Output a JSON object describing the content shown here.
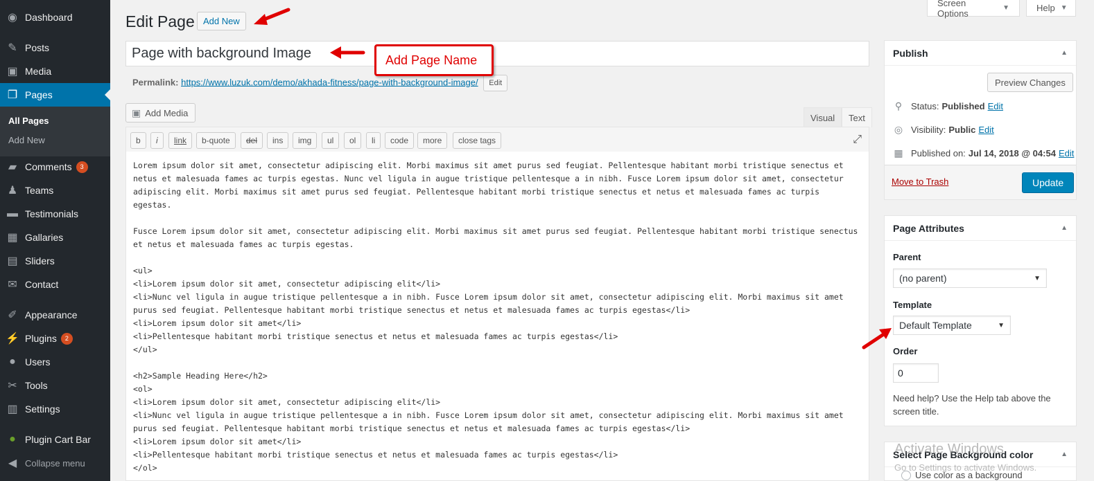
{
  "sidebar": {
    "items": [
      {
        "label": "Dashboard",
        "icon": "dashboard-icon"
      },
      {
        "label": "Posts",
        "icon": "pin-icon"
      },
      {
        "label": "Media",
        "icon": "media-icon"
      },
      {
        "label": "Pages",
        "icon": "pages-icon"
      },
      {
        "label": "Comments",
        "icon": "comment-icon",
        "badge": "3"
      },
      {
        "label": "Teams",
        "icon": "group-icon"
      },
      {
        "label": "Testimonials",
        "icon": "testimonial-icon"
      },
      {
        "label": "Gallaries",
        "icon": "gallery-icon"
      },
      {
        "label": "Sliders",
        "icon": "slides-icon"
      },
      {
        "label": "Contact",
        "icon": "email-icon"
      },
      {
        "label": "Appearance",
        "icon": "brush-icon"
      },
      {
        "label": "Plugins",
        "icon": "plugin-icon",
        "badge": "2"
      },
      {
        "label": "Users",
        "icon": "user-icon"
      },
      {
        "label": "Tools",
        "icon": "wrench-icon"
      },
      {
        "label": "Settings",
        "icon": "settings-icon"
      },
      {
        "label": "Plugin Cart Bar",
        "icon": "leaf-icon"
      }
    ],
    "submenu": {
      "all_pages": "All Pages",
      "add_new": "Add New"
    },
    "collapse": "Collapse menu",
    "accent": "#0073aa"
  },
  "screen_options": "Screen Options",
  "help": "Help",
  "heading": "Edit Page",
  "add_new": "Add New",
  "title_value": "Page with background Image",
  "annotation_label": "Add Page Name",
  "permalink": {
    "label": "Permalink:",
    "url": "https://www.luzuk.com/demo/akhada-fitness/page-with-background-image/",
    "edit": "Edit"
  },
  "editor": {
    "add_media": "Add Media",
    "tab_visual": "Visual",
    "tab_text": "Text",
    "quicktags": [
      "b",
      "i",
      "link",
      "b-quote",
      "del",
      "ins",
      "img",
      "ul",
      "ol",
      "li",
      "code",
      "more",
      "close tags"
    ],
    "content": "Lorem ipsum dolor sit amet, consectetur adipiscing elit. Morbi maximus sit amet purus sed feugiat. Pellentesque habitant morbi tristique senectus et netus et malesuada fames ac turpis egestas. Nunc vel ligula in augue tristique pellentesque a in nibh. Fusce Lorem ipsum dolor sit amet, consectetur adipiscing elit. Morbi maximus sit amet purus sed feugiat. Pellentesque habitant morbi tristique senectus et netus et malesuada fames ac turpis egestas.\n\nFusce Lorem ipsum dolor sit amet, consectetur adipiscing elit. Morbi maximus sit amet purus sed feugiat. Pellentesque habitant morbi tristique senectus et netus et malesuada fames ac turpis egestas.\n\n<ul>\n<li>Lorem ipsum dolor sit amet, consectetur adipiscing elit</li>\n<li>Nunc vel ligula in augue tristique pellentesque a in nibh. Fusce Lorem ipsum dolor sit amet, consectetur adipiscing elit. Morbi maximus sit amet purus sed feugiat. Pellentesque habitant morbi tristique senectus et netus et malesuada fames ac turpis egestas</li>\n<li>Lorem ipsum dolor sit amet</li>\n<li>Pellentesque habitant morbi tristique senectus et netus et malesuada fames ac turpis egestas</li>\n</ul>\n\n<h2>Sample Heading Here</h2>\n<ol>\n<li>Lorem ipsum dolor sit amet, consectetur adipiscing elit</li>\n<li>Nunc vel ligula in augue tristique pellentesque a in nibh. Fusce Lorem ipsum dolor sit amet, consectetur adipiscing elit. Morbi maximus sit amet purus sed feugiat. Pellentesque habitant morbi tristique senectus et netus et malesuada fames ac turpis egestas</li>\n<li>Lorem ipsum dolor sit amet</li>\n<li>Pellentesque habitant morbi tristique senectus et netus et malesuada fames ac turpis egestas</li>\n</ol>"
  },
  "publish": {
    "title": "Publish",
    "preview": "Preview Changes",
    "status_label": "Status:",
    "status_value": "Published",
    "visibility_label": "Visibility:",
    "visibility_value": "Public",
    "published_label": "Published on:",
    "published_value": "Jul 14, 2018 @ 04:54",
    "edit": "Edit",
    "trash": "Move to Trash",
    "update": "Update"
  },
  "attributes": {
    "title": "Page Attributes",
    "parent_label": "Parent",
    "parent_value": "(no parent)",
    "template_label": "Template",
    "template_value": "Default Template",
    "order_label": "Order",
    "order_value": "0",
    "help": "Need help? Use the Help tab above the screen title."
  },
  "bg_box": {
    "title": "Select Page Background color",
    "option": "Use color as a background"
  },
  "watermark": {
    "line1": "Activate Windows",
    "line2": "Go to Settings to activate Windows."
  }
}
